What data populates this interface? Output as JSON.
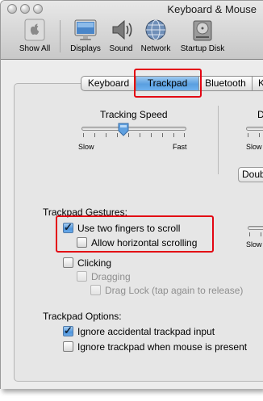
{
  "window": {
    "title": "Keyboard & Mouse"
  },
  "toolbar": {
    "items": [
      {
        "label": "Show All",
        "icon": "apple-icon"
      },
      {
        "label": "Displays",
        "icon": "display-icon"
      },
      {
        "label": "Sound",
        "icon": "speaker-icon"
      },
      {
        "label": "Network",
        "icon": "globe-icon"
      },
      {
        "label": "Startup Disk",
        "icon": "hard-disk-icon"
      }
    ]
  },
  "tabs": [
    {
      "label": "Keyboard",
      "active": false
    },
    {
      "label": "Trackpad",
      "active": true
    },
    {
      "label": "Bluetooth",
      "active": false
    },
    {
      "label": "K",
      "active": false
    }
  ],
  "tracking_speed": {
    "label": "Tracking Speed",
    "min_label": "Slow",
    "max_label": "Fast",
    "value_fraction": 0.4
  },
  "second_slider": {
    "label": "D",
    "min_label": "Slow"
  },
  "popup": {
    "value": "Doub"
  },
  "gestures": {
    "heading": "Trackpad Gestures:",
    "items": [
      {
        "label": "Use two fingers to scroll",
        "checked": true,
        "enabled": true
      },
      {
        "label": "Allow horizontal scrolling",
        "checked": false,
        "enabled": true
      },
      {
        "label": "Clicking",
        "checked": false,
        "enabled": true
      },
      {
        "label": "Dragging",
        "checked": false,
        "enabled": false
      },
      {
        "label": "Drag Lock (tap again to release)",
        "checked": false,
        "enabled": false
      }
    ]
  },
  "third_slider": {
    "min_label": "Slow"
  },
  "options": {
    "heading": "Trackpad Options:",
    "items": [
      {
        "label": "Ignore accidental trackpad input",
        "checked": true
      },
      {
        "label": "Ignore trackpad when mouse is present",
        "checked": false
      }
    ]
  },
  "colors": {
    "highlight": "#e30613",
    "selection_blue": "#5a9fe0"
  }
}
